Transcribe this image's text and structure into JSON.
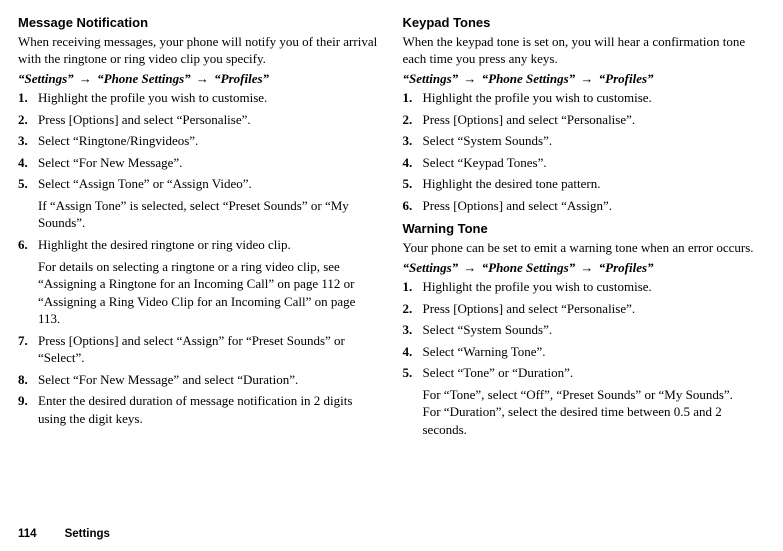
{
  "left": {
    "msg": {
      "heading": "Message Notification",
      "intro": "When receiving messages, your phone will notify you of their arrival with the ringtone or ring video clip you specify.",
      "path": [
        "“Settings”",
        "“Phone Settings”",
        "“Profiles”"
      ],
      "steps": [
        {
          "num": "1.",
          "text": "Highlight the profile you wish to customise."
        },
        {
          "num": "2.",
          "text": "Press [Options] and select “Personalise”."
        },
        {
          "num": "3.",
          "text": "Select “Ringtone/Ringvideos”."
        },
        {
          "num": "4.",
          "text": "Select “For New Message”."
        },
        {
          "num": "5.",
          "text": "Select “Assign Tone” or “Assign Video”.",
          "sub": "If “Assign Tone” is selected, select “Preset Sounds” or “My Sounds”."
        },
        {
          "num": "6.",
          "text": "Highlight the desired ringtone or ring video clip.",
          "sub": "For details on selecting a ringtone or a ring video clip, see “Assigning a Ringtone for an Incoming Call” on page 112 or “Assigning a Ring Video Clip for an Incoming Call” on page 113."
        },
        {
          "num": "7.",
          "text": "Press [Options] and select “Assign” for “Preset Sounds” or “Select”."
        },
        {
          "num": "8.",
          "text": "Select “For New Message” and select “Duration”."
        },
        {
          "num": "9.",
          "text": "Enter the desired duration of message notification in 2 digits using the digit keys."
        }
      ]
    }
  },
  "right": {
    "keypad": {
      "heading": "Keypad Tones",
      "intro": "When the keypad tone is set on, you will hear a confirmation tone each time you press any keys.",
      "path": [
        "“Settings”",
        "“Phone Settings”",
        "“Profiles”"
      ],
      "steps": [
        {
          "num": "1.",
          "text": "Highlight the profile you wish to customise."
        },
        {
          "num": "2.",
          "text": "Press [Options] and select “Personalise”."
        },
        {
          "num": "3.",
          "text": "Select “System Sounds”."
        },
        {
          "num": "4.",
          "text": "Select “Keypad Tones”."
        },
        {
          "num": "5.",
          "text": "Highlight the desired tone pattern."
        },
        {
          "num": "6.",
          "text": "Press [Options] and select “Assign”."
        }
      ]
    },
    "warning": {
      "heading": "Warning Tone",
      "intro": "Your phone can be set to emit a warning tone when an error occurs.",
      "path": [
        "“Settings”",
        "“Phone Settings”",
        "“Profiles”"
      ],
      "steps": [
        {
          "num": "1.",
          "text": "Highlight the profile you wish to customise."
        },
        {
          "num": "2.",
          "text": "Press [Options] and select “Personalise”."
        },
        {
          "num": "3.",
          "text": "Select “System Sounds”."
        },
        {
          "num": "4.",
          "text": "Select “Warning Tone”."
        },
        {
          "num": "5.",
          "text": "Select “Tone” or “Duration”.",
          "sub": "For “Tone”, select “Off”, “Preset Sounds” or “My Sounds”.\nFor “Duration”, select the desired time between 0.5 and 2 seconds."
        }
      ]
    }
  },
  "footer": {
    "page": "114",
    "section": "Settings"
  }
}
